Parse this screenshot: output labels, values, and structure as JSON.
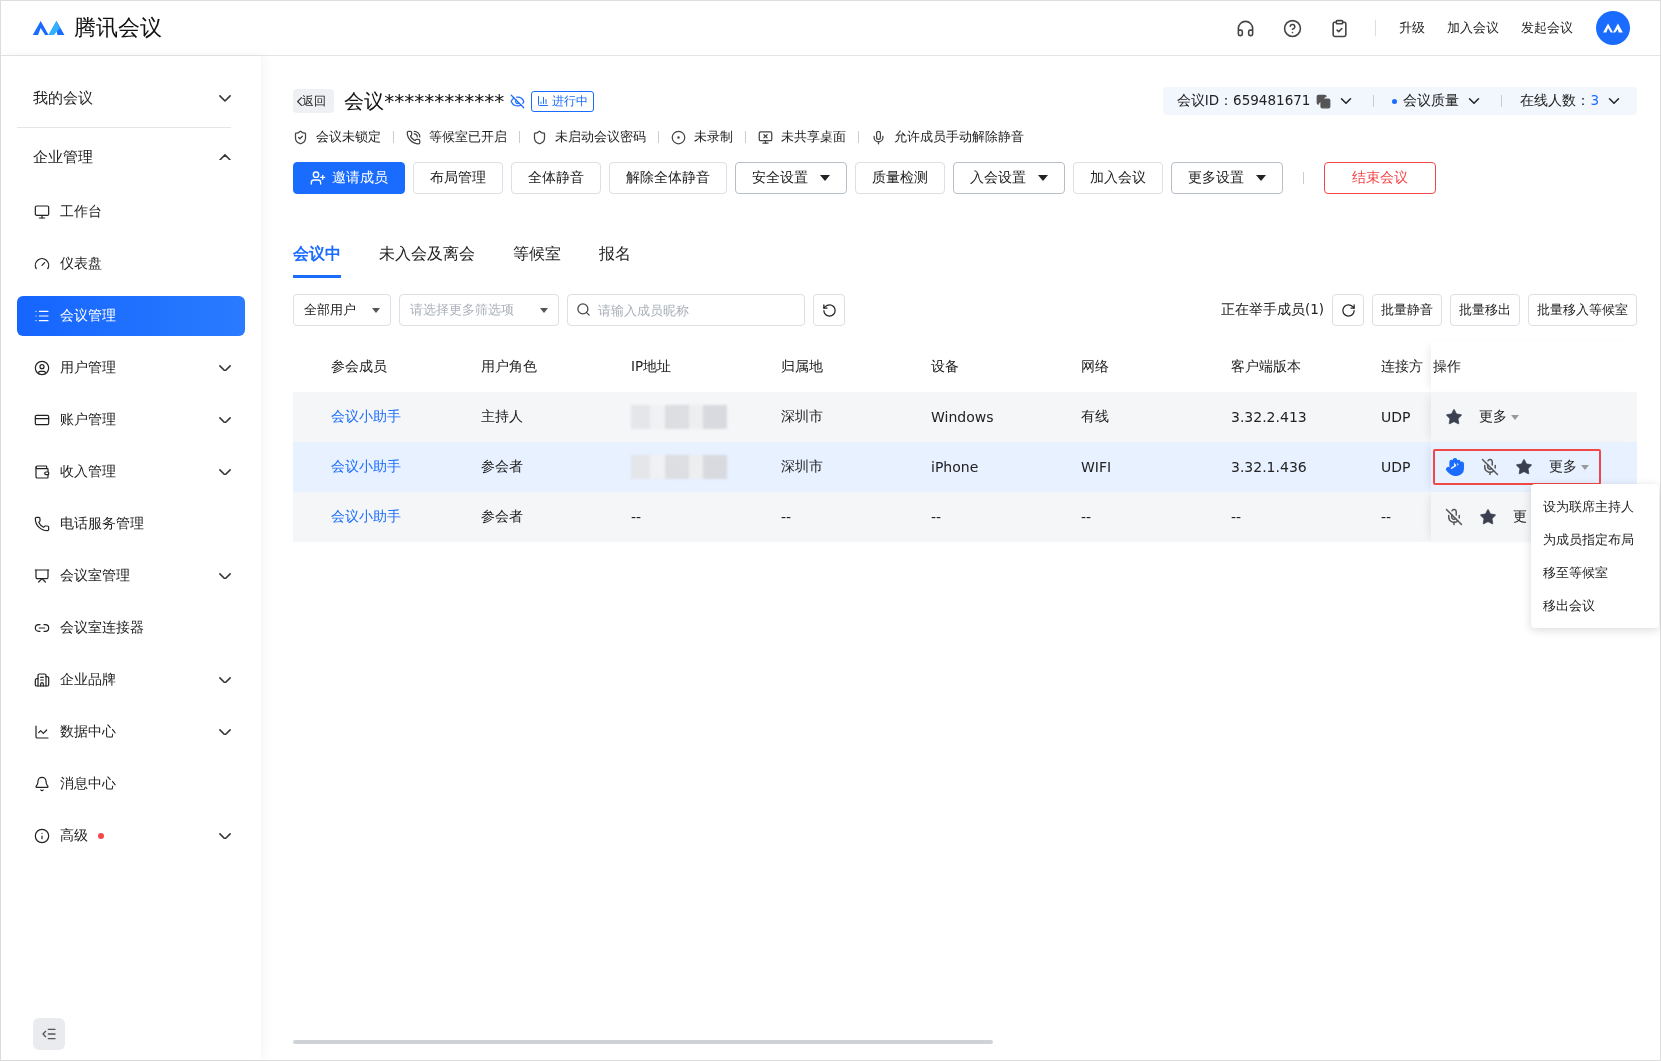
{
  "app": {
    "name": "腾讯会议"
  },
  "header": {
    "icons": [
      {
        "kind": "headset"
      },
      {
        "kind": "help"
      },
      {
        "kind": "clipboard"
      }
    ],
    "links": [
      "升级",
      "加入会议",
      "发起会议"
    ]
  },
  "sidebar": {
    "items": [
      {
        "label": "我的会议",
        "expanded": false,
        "selected": false
      },
      {
        "label": "企业管理",
        "expanded": true,
        "selected": false,
        "children": [
          {
            "label": "工作台",
            "selected": false
          },
          {
            "label": "仪表盘",
            "selected": false
          },
          {
            "label": "会议管理",
            "selected": true
          },
          {
            "label": "用户管理",
            "selected": false,
            "expanded": false
          },
          {
            "label": "账户管理",
            "selected": false,
            "expanded": false
          },
          {
            "label": "收入管理",
            "selected": false,
            "expanded": false
          },
          {
            "label": "电话服务管理",
            "selected": false
          },
          {
            "label": "会议室管理",
            "selected": false,
            "expanded": false
          },
          {
            "label": "会议室连接器",
            "selected": false
          },
          {
            "label": "企业品牌",
            "selected": false,
            "expanded": false
          },
          {
            "label": "数据中心",
            "selected": false,
            "expanded": false
          },
          {
            "label": "消息中心",
            "selected": false
          },
          {
            "label": "高级",
            "selected": false,
            "expanded": false,
            "dot": true
          }
        ]
      }
    ]
  },
  "meeting": {
    "back": "返回",
    "title": "会议************",
    "status": "进行中",
    "info": {
      "id_label": "会议ID：",
      "id": "659481671",
      "quality": "会议质量",
      "online_label": "在线人数：",
      "online": "3"
    },
    "flags": [
      {
        "kind": "lock",
        "label": "会议未锁定"
      },
      {
        "kind": "waiting",
        "label": "等候室已开启"
      },
      {
        "kind": "shield",
        "label": "未启动会议密码"
      },
      {
        "kind": "record",
        "label": "未录制"
      },
      {
        "kind": "screen",
        "label": "未共享桌面"
      },
      {
        "kind": "mic",
        "label": "允许成员手动解除静音"
      }
    ],
    "buttons": [
      {
        "kind": "primary",
        "label": "邀请成员"
      },
      {
        "kind": "default",
        "label": "布局管理"
      },
      {
        "kind": "default",
        "label": "全体静音"
      },
      {
        "kind": "default",
        "label": "解除全体静音"
      },
      {
        "kind": "dropdown",
        "label": "安全设置"
      },
      {
        "kind": "default",
        "label": "质量检测"
      },
      {
        "kind": "dropdown",
        "label": "入会设置"
      },
      {
        "kind": "default",
        "label": "加入会议"
      },
      {
        "kind": "dropdown",
        "label": "更多设置"
      },
      {
        "kind": "danger",
        "label": "结束会议"
      }
    ]
  },
  "tabs": [
    {
      "label": "会议中",
      "selected": true
    },
    {
      "label": "未入会及离会",
      "selected": false
    },
    {
      "label": "等候室",
      "selected": false
    },
    {
      "label": "报名",
      "selected": false
    }
  ],
  "filters": {
    "user_select": "全部用户",
    "more_select": {
      "placeholder": "请选择更多筛选项"
    },
    "search": {
      "placeholder": "请输入成员昵称"
    },
    "raised": "正在举手成员(1)",
    "batch": [
      "批量静音",
      "批量移出",
      "批量移入等候室"
    ]
  },
  "table": {
    "columns": [
      "参会成员",
      "用户角色",
      "IP地址",
      "归属地",
      "设备",
      "网络",
      "客户端版本",
      "连接方",
      "操作"
    ],
    "rows": [
      {
        "selected": false,
        "name": "会议小助手",
        "role": "主持人",
        "ip_hidden": true,
        "location": "深圳市",
        "device": "Windows",
        "network": "有线",
        "version": "3.32.2.413",
        "connection": "UDP",
        "actions": [
          {
            "kind": "star"
          },
          {
            "kind": "more",
            "label": "更多"
          }
        ]
      },
      {
        "selected": true,
        "name": "会议小助手",
        "role": "参会者",
        "ip_hidden": true,
        "location": "深圳市",
        "device": "iPhone",
        "network": "WIFI",
        "version": "3.32.1.436",
        "connection": "UDP",
        "actions": [
          {
            "kind": "hand"
          },
          {
            "kind": "mic_off"
          },
          {
            "kind": "star"
          },
          {
            "kind": "more",
            "label": "更多"
          }
        ]
      },
      {
        "selected": false,
        "name": "会议小助手",
        "role": "参会者",
        "ip_hidden": false,
        "ip": "--",
        "location": "--",
        "device": "--",
        "network": "--",
        "version": "--",
        "connection": "--",
        "actions": [
          {
            "kind": "mic_off"
          },
          {
            "kind": "star"
          },
          {
            "kind": "more_cut",
            "label": "更"
          }
        ]
      }
    ]
  },
  "menu": {
    "items": [
      "设为联席主持人",
      "为成员指定布局",
      "移至等候室",
      "移出会议"
    ]
  }
}
